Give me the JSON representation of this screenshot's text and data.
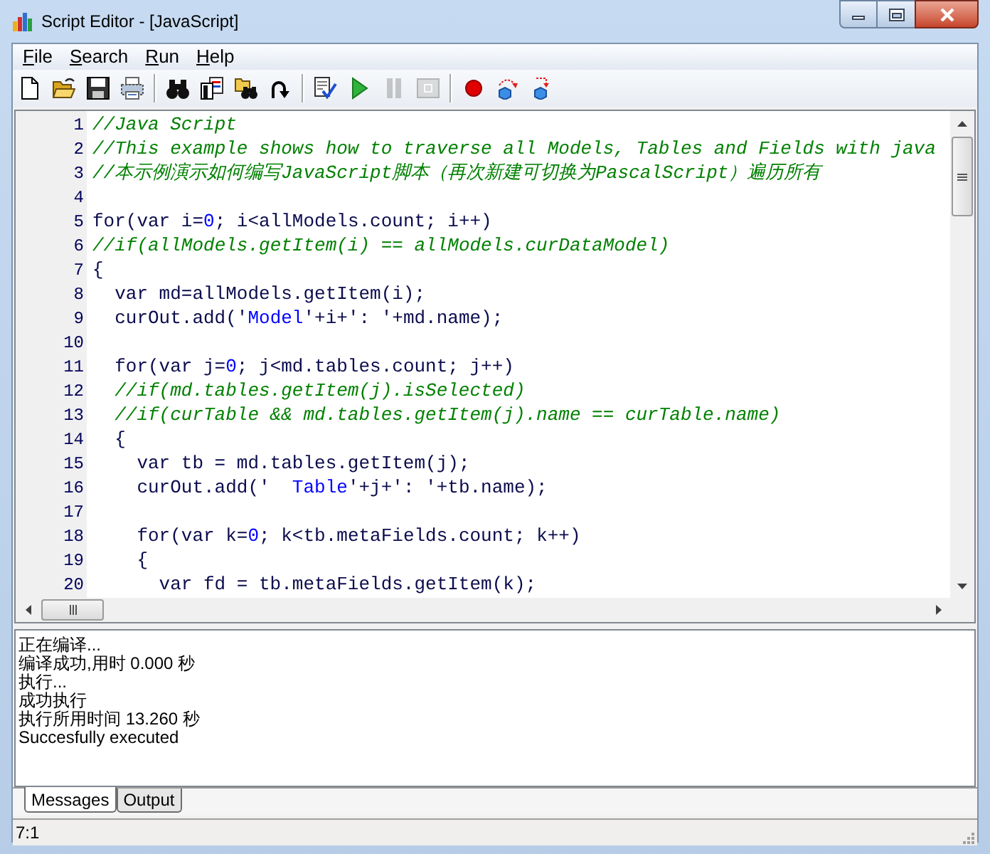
{
  "window": {
    "title": "Script Editor - [JavaScript]"
  },
  "menu": [
    {
      "label": "File"
    },
    {
      "label": "Search"
    },
    {
      "label": "Run"
    },
    {
      "label": "Help"
    }
  ],
  "toolbar": [
    [
      {
        "kind": "new",
        "disabled": false
      },
      {
        "kind": "open",
        "disabled": false
      },
      {
        "kind": "save",
        "disabled": false
      },
      {
        "kind": "print",
        "disabled": false
      }
    ],
    [
      {
        "kind": "find",
        "disabled": false
      },
      {
        "kind": "replace",
        "disabled": false
      },
      {
        "kind": "find_next",
        "disabled": false
      },
      {
        "kind": "goto",
        "disabled": false
      }
    ],
    [
      {
        "kind": "compile",
        "disabled": false
      },
      {
        "kind": "run",
        "disabled": false
      },
      {
        "kind": "pause",
        "disabled": true
      },
      {
        "kind": "stop",
        "disabled": true
      }
    ],
    [
      {
        "kind": "breakpoint",
        "disabled": false
      },
      {
        "kind": "step_over",
        "disabled": false
      },
      {
        "kind": "step_into",
        "disabled": false
      }
    ]
  ],
  "editor": {
    "lines": [
      {
        "number": "1",
        "segments": [
          {
            "kind": "comment",
            "text": "//Java Script"
          }
        ]
      },
      {
        "number": "2",
        "segments": [
          {
            "kind": "comment",
            "text": "//This example shows how to traverse all Models, Tables and Fields with java"
          }
        ]
      },
      {
        "number": "3",
        "segments": [
          {
            "kind": "comment",
            "text": "//本示例演示如何编写JavaScript脚本（再次新建可切换为PascalScript）遍历所有"
          }
        ]
      },
      {
        "number": "4"
      },
      {
        "number": "5",
        "segments": [
          {
            "kind": "plain",
            "text": "for(var i="
          },
          {
            "kind": "literal",
            "text": "0"
          },
          {
            "kind": "plain",
            "text": "; i<allModels.count; i++)"
          }
        ]
      },
      {
        "number": "6",
        "segments": [
          {
            "kind": "comment",
            "text": "//if(allModels.getItem(i) == allModels.curDataModel)"
          }
        ]
      },
      {
        "number": "7",
        "segments": [
          {
            "kind": "plain",
            "text": "{"
          }
        ]
      },
      {
        "number": "8",
        "segments": [
          {
            "kind": "plain",
            "text": "  var md=allModels.getItem(i);"
          }
        ]
      },
      {
        "number": "9",
        "segments": [
          {
            "kind": "plain",
            "text": "  curOut.add('"
          },
          {
            "kind": "literal",
            "text": "Model"
          },
          {
            "kind": "plain",
            "text": "'+i+': '+md.name);"
          }
        ]
      },
      {
        "number": "10"
      },
      {
        "number": "11",
        "segments": [
          {
            "kind": "plain",
            "text": "  for(var j="
          },
          {
            "kind": "literal",
            "text": "0"
          },
          {
            "kind": "plain",
            "text": "; j<md.tables.count; j++)"
          }
        ]
      },
      {
        "number": "12",
        "segments": [
          {
            "kind": "comment",
            "text": "  //if(md.tables.getItem(j).isSelected)"
          }
        ]
      },
      {
        "number": "13",
        "segments": [
          {
            "kind": "comment",
            "text": "  //if(curTable && md.tables.getItem(j).name == curTable.name)"
          }
        ]
      },
      {
        "number": "14",
        "segments": [
          {
            "kind": "plain",
            "text": "  {"
          }
        ]
      },
      {
        "number": "15",
        "segments": [
          {
            "kind": "plain",
            "text": "    var tb = md.tables.getItem(j);"
          }
        ]
      },
      {
        "number": "16",
        "segments": [
          {
            "kind": "plain",
            "text": "    curOut.add('  "
          },
          {
            "kind": "literal",
            "text": "Table"
          },
          {
            "kind": "plain",
            "text": "'+j+': '+tb.name);"
          }
        ]
      },
      {
        "number": "17"
      },
      {
        "number": "18",
        "segments": [
          {
            "kind": "plain",
            "text": "    for(var k="
          },
          {
            "kind": "literal",
            "text": "0"
          },
          {
            "kind": "plain",
            "text": "; k<tb.metaFields.count; k++)"
          }
        ]
      },
      {
        "number": "19",
        "segments": [
          {
            "kind": "plain",
            "text": "    {"
          }
        ]
      },
      {
        "number": "20",
        "segments": [
          {
            "kind": "plain",
            "text": "      var fd = tb.metaFields.getItem(k);"
          }
        ]
      }
    ]
  },
  "messages": [
    "正在编译...",
    "编译成功,用时 0.000 秒",
    "执行...",
    "成功执行",
    "执行所用时间 13.260 秒",
    "Succesfully executed"
  ],
  "tabs": [
    {
      "label": "Messages",
      "selected": true
    },
    {
      "label": "Output",
      "selected": false
    }
  ],
  "status_bar": {
    "position": "7:1"
  }
}
